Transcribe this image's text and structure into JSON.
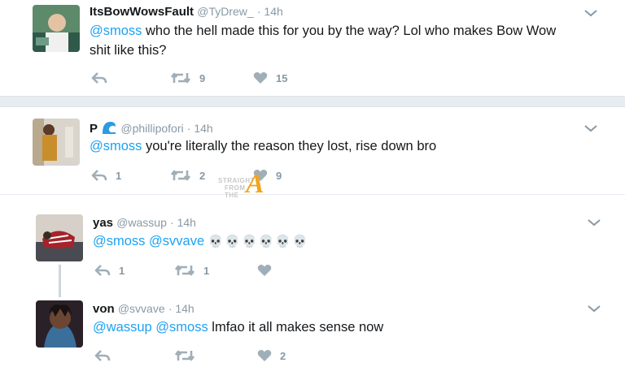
{
  "tweets": [
    {
      "name": "ItsBowWowsFault",
      "handle": "@TyDrew_",
      "time": "· 14h",
      "mention1": "@smoss",
      "text1": " who the hell made this for you by the way? Lol who makes Bow Wow",
      "text2": "shit like this?",
      "reply_count": "",
      "retweet_count": "9",
      "like_count": "15"
    },
    {
      "name": "P",
      "handle": "@phillipofori",
      "time": "· 14h",
      "mention1": "@smoss",
      "text1": " you're literally the reason they lost, rise down bro",
      "reply_count": "1",
      "retweet_count": "2",
      "like_count": "9"
    },
    {
      "name": "yas",
      "handle": "@wassup",
      "time": "· 14h",
      "mention1": "@smoss",
      "mention2": "@svvave",
      "emoji": "💀💀💀💀💀💀",
      "reply_count": "1",
      "retweet_count": "1",
      "like_count": ""
    },
    {
      "name": "von",
      "handle": "@svvave",
      "time": "· 14h",
      "mention1": "@wassup",
      "mention2": "@smoss",
      "text1": " lmfao it all makes sense now",
      "reply_count": "",
      "retweet_count": "",
      "like_count": "2"
    }
  ],
  "watermark": {
    "line1": "STRAIGHT",
    "line2": "FROM",
    "line3": "THE",
    "letter": "A"
  },
  "colors": {
    "link": "#1da1f2",
    "icon": "#a0aeb8",
    "separator": "#e6ecf0"
  }
}
